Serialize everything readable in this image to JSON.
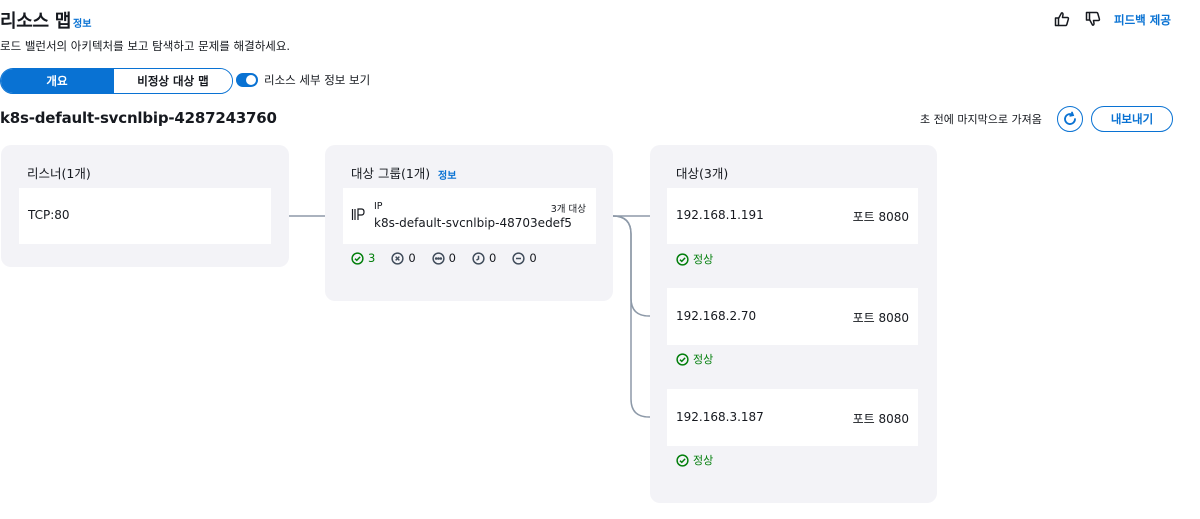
{
  "header": {
    "title": "리소스 맵",
    "info": "정보",
    "subtitle": "로드 밸런서의 아키텍처를 보고 탐색하고 문제를 해결하세요.",
    "feedback": "피드백 제공"
  },
  "tabs": {
    "overview": "개요",
    "unhealthy_map": "비정상 대상 맵"
  },
  "toggle": {
    "label": "리소스 세부 정보 보기",
    "on": true
  },
  "load_balancer": {
    "name": "k8s-default-svcnlbip-4287243760",
    "last_fetch": "초 전에 마지막으로 가져옴",
    "export_label": "내보내기"
  },
  "listeners": {
    "title": "리스너(1개)",
    "items": [
      {
        "protocol_port": "TCP:80"
      }
    ]
  },
  "target_groups": {
    "title": "대상 그룹(1개)",
    "info": "정보",
    "items": [
      {
        "type": "IP",
        "name": "k8s-default-svcnlbip-48703edef5",
        "target_count": "3개 대상",
        "status_counts": {
          "healthy": "3",
          "unhealthy": "0",
          "pending": "0",
          "draining": "0",
          "unused": "0"
        }
      }
    ]
  },
  "targets": {
    "title": "대상(3개)",
    "items": [
      {
        "ip": "192.168.1.191",
        "port": "포트 8080",
        "status": "정상"
      },
      {
        "ip": "192.168.2.70",
        "port": "포트 8080",
        "status": "정상"
      },
      {
        "ip": "192.168.3.187",
        "port": "포트 8080",
        "status": "정상"
      }
    ]
  },
  "colors": {
    "accent": "#0972d3",
    "healthy": "#037f0c",
    "panel_bg": "#f3f3f7",
    "connector": "#8d99a8"
  }
}
